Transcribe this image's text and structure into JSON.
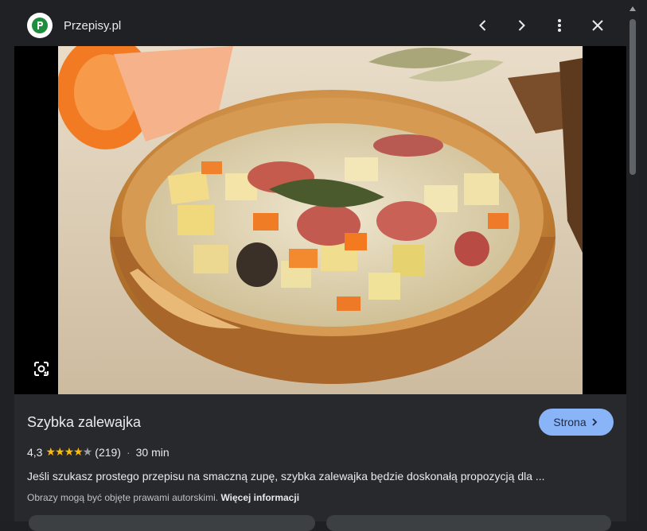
{
  "header": {
    "site_name": "Przepisy.pl",
    "icons": [
      "site-logo",
      "chevron-left-icon",
      "chevron-right-icon",
      "more-vert-icon",
      "close-icon"
    ]
  },
  "image": {
    "subject": "bowl-of-zalewajka-soup",
    "lens_icon": "google-lens-icon"
  },
  "info": {
    "title": "Szybka zalewajka",
    "visit_button": "Strona",
    "rating_value": "4,3",
    "rating_stars": 4.3,
    "rating_count": "(219)",
    "separator": "·",
    "time": "30 min",
    "description": "Jeśli szukasz prostego przepisu na smaczną zupę, szybka zalewajka będzie doskonałą propozycją dla ...",
    "copyright_text": "Obrazy mogą być objęte prawami autorskimi.",
    "more_info_link": "Więcej informacji"
  },
  "colors": {
    "panel_bg": "#202124",
    "info_bg": "#28292c",
    "accent_button": "#8ab4f8",
    "star": "#fbbc04",
    "logo_green": "#1e8e3e"
  }
}
